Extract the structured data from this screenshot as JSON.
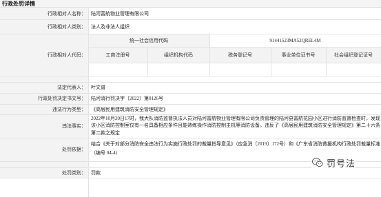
{
  "header": {
    "title": "行政处罚详情"
  },
  "fields": {
    "counterpart_name": {
      "label": "行政相对人名称：",
      "value": "陆河富航物业管理有限公司"
    },
    "counterpart_category": {
      "label": "行政相对人类别：",
      "value": "法人及非法人组织"
    },
    "counterpart_code": {
      "label": "行政相对人代码：",
      "credit_code_label": "统一社会信用代码",
      "credit_code_value": "91441523MA52QREL4M",
      "sub_headers": [
        "工商注册号",
        "组织机构代码",
        "税务登记号",
        "事业单位证书号",
        "社会组织登记证号"
      ],
      "sub_values": [
        "",
        "",
        "",
        "",
        ""
      ]
    },
    "legal_rep": {
      "label": "法定代表人：",
      "value": "叶文谱"
    },
    "decision_no": {
      "label": "行政处罚决定书文号：",
      "value": "陆河消行罚决字〔2022〕第0126号"
    },
    "violation_type": {
      "label": "违法行为类型：",
      "value": "《高层民用建筑消防安全管理规定》"
    },
    "violation_facts": {
      "label": "违法事实：",
      "lines": [
        "2022年10月20日17时，我大队消防监督执法人员对陆河富航物业管理有限公司负责管理的陆河县富航花园小区进行消防监督检查时，发现",
        "该小区消防控制室仅有一名具备相应条件且能熟练操作消防控制主机等消防设备。违反了《高层民用建筑消防安全管理规定》第二十六条",
        "第二款之规定"
      ]
    },
    "basis": {
      "label": "处罚依据：",
      "lines": [
        "结合《关于对部分消防安全违法行为实施行政处罚的裁量指导意见》（应急消〔2019〕172号）和《广东省消防救援机构行政处罚裁量标准",
        "（编号 04-4）"
      ]
    },
    "category": {
      "label": "处罚类别：",
      "value": "罚款"
    }
  },
  "watermark": {
    "text": "罚号法",
    "icon": "wechat-icon"
  }
}
